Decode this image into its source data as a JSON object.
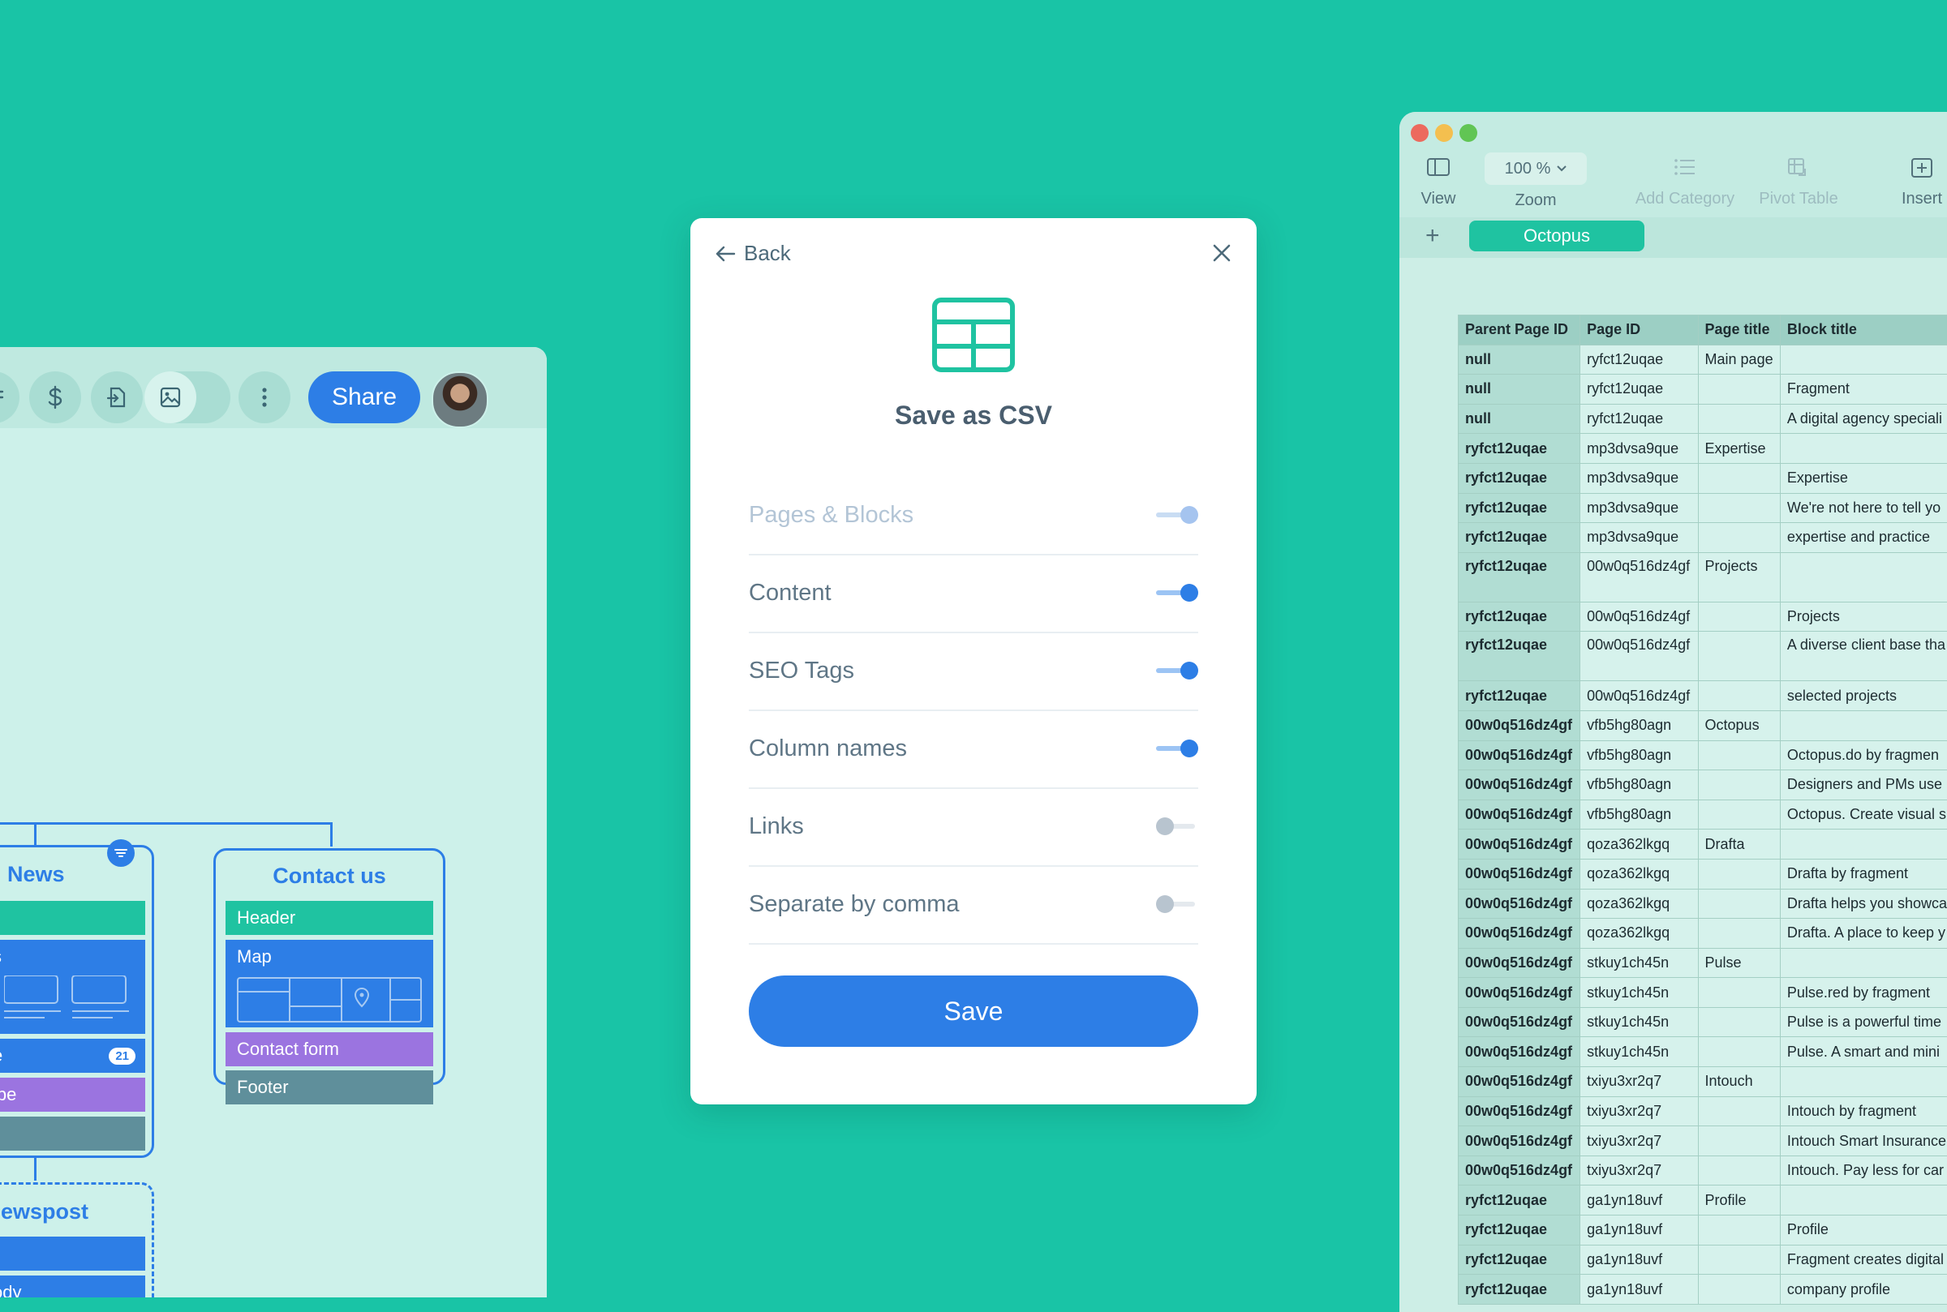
{
  "colors": {
    "background": "#19c4a6",
    "accent": "#2d7ee6",
    "green_block": "#1fc3a1",
    "purple_block": "#9b74e0",
    "slate_block": "#5f8f9b"
  },
  "left_panel": {
    "toolbar": {
      "icons": [
        "menu-icon",
        "dollar-icon",
        "export-icon",
        "image-icon",
        "more-icon"
      ],
      "share_label": "Share"
    },
    "news_card": {
      "title": "News",
      "blocks": [
        {
          "label": "r",
          "color": "green"
        },
        {
          "label": "s",
          "color": "blue"
        },
        {
          "label": "e",
          "color": "blue",
          "badge": "21"
        },
        {
          "label": "ibe",
          "color": "purple"
        },
        {
          "label": "",
          "color": "slate"
        }
      ]
    },
    "contact_card": {
      "title": "Contact us",
      "blocks": [
        {
          "label": "Header",
          "color": "green"
        },
        {
          "label": "Map",
          "color": "blue"
        },
        {
          "label": "Contact form",
          "color": "purple"
        },
        {
          "label": "Footer",
          "color": "slate"
        }
      ]
    },
    "newspost_card": {
      "title": "ewspost",
      "blocks": [
        {
          "label": "",
          "color": "blue"
        },
        {
          "label": "ody",
          "color": "blue"
        }
      ]
    }
  },
  "modal": {
    "back_label": "Back",
    "title": "Save as CSV",
    "options": [
      {
        "label": "Pages & Blocks",
        "state": "on",
        "disabled": true
      },
      {
        "label": "Content",
        "state": "on",
        "disabled": false
      },
      {
        "label": "SEO Tags",
        "state": "on",
        "disabled": false
      },
      {
        "label": "Column names",
        "state": "on",
        "disabled": false
      },
      {
        "label": "Links",
        "state": "off",
        "disabled": false
      },
      {
        "label": "Separate by comma",
        "state": "off",
        "disabled": false
      }
    ],
    "save_label": "Save"
  },
  "sheet": {
    "toolbar": {
      "view_label": "View",
      "zoom_value": "100 %",
      "zoom_label": "Zoom",
      "add_category_label": "Add Category",
      "pivot_table_label": "Pivot Table",
      "insert_label": "Insert"
    },
    "tab_name": "Octopus",
    "columns": [
      "Parent Page ID",
      "Page ID",
      "Page title",
      "Block title"
    ],
    "rows": [
      [
        "null",
        "ryfct12uqae",
        "Main page",
        ""
      ],
      [
        "null",
        "ryfct12uqae",
        "",
        "Fragment"
      ],
      [
        "null",
        "ryfct12uqae",
        "",
        "A digital agency speciali"
      ],
      [
        "ryfct12uqae",
        "mp3dvsa9que",
        "Expertise",
        ""
      ],
      [
        "ryfct12uqae",
        "mp3dvsa9que",
        "",
        "Expertise"
      ],
      [
        "ryfct12uqae",
        "mp3dvsa9que",
        "",
        "We're not here to tell yo"
      ],
      [
        "ryfct12uqae",
        "mp3dvsa9que",
        "",
        "expertise and practice"
      ],
      [
        "ryfct12uqae",
        "00w0q516dz4gf",
        "Projects",
        ""
      ],
      [
        "ryfct12uqae",
        "00w0q516dz4gf",
        "",
        "Projects"
      ],
      [
        "ryfct12uqae",
        "00w0q516dz4gf",
        "",
        "A diverse client base tha"
      ],
      [
        "ryfct12uqae",
        "00w0q516dz4gf",
        "",
        "selected projects"
      ],
      [
        "00w0q516dz4gf",
        "vfb5hg80agn",
        "Octopus",
        ""
      ],
      [
        "00w0q516dz4gf",
        "vfb5hg80agn",
        "",
        "Octopus.do by fragmen"
      ],
      [
        "00w0q516dz4gf",
        "vfb5hg80agn",
        "",
        "Designers and PMs use"
      ],
      [
        "00w0q516dz4gf",
        "vfb5hg80agn",
        "",
        "Octopus. Create visual s"
      ],
      [
        "00w0q516dz4gf",
        "qoza362lkgq",
        "Drafta",
        ""
      ],
      [
        "00w0q516dz4gf",
        "qoza362lkgq",
        "",
        "Drafta by fragment"
      ],
      [
        "00w0q516dz4gf",
        "qoza362lkgq",
        "",
        "Drafta helps you showca"
      ],
      [
        "00w0q516dz4gf",
        "qoza362lkgq",
        "",
        "Drafta. A place to keep y"
      ],
      [
        "00w0q516dz4gf",
        "stkuy1ch45n",
        "Pulse",
        ""
      ],
      [
        "00w0q516dz4gf",
        "stkuy1ch45n",
        "",
        "Pulse.red by fragment"
      ],
      [
        "00w0q516dz4gf",
        "stkuy1ch45n",
        "",
        "Pulse is a powerful time"
      ],
      [
        "00w0q516dz4gf",
        "stkuy1ch45n",
        "",
        "Pulse. A smart and mini"
      ],
      [
        "00w0q516dz4gf",
        "txiyu3xr2q7",
        "Intouch",
        ""
      ],
      [
        "00w0q516dz4gf",
        "txiyu3xr2q7",
        "",
        "Intouch by fragment"
      ],
      [
        "00w0q516dz4gf",
        "txiyu3xr2q7",
        "",
        "Intouch Smart Insurance"
      ],
      [
        "00w0q516dz4gf",
        "txiyu3xr2q7",
        "",
        "Intouch. Pay less for car"
      ],
      [
        "ryfct12uqae",
        "ga1yn18uvf",
        "Profile",
        ""
      ],
      [
        "ryfct12uqae",
        "ga1yn18uvf",
        "",
        "Profile"
      ],
      [
        "ryfct12uqae",
        "ga1yn18uvf",
        "",
        "Fragment creates digital"
      ],
      [
        "ryfct12uqae",
        "ga1yn18uvf",
        "",
        "company profile"
      ]
    ],
    "tall_rows": [
      7,
      9
    ]
  }
}
